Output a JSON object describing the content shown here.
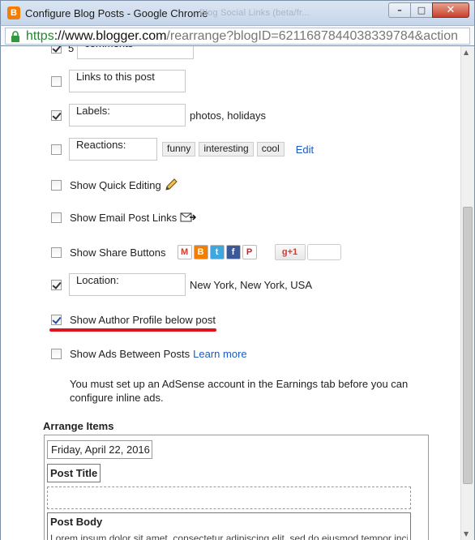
{
  "window": {
    "title": "Configure Blog Posts - Google Chrome",
    "background_tabs": "Blog               Social Links (beta/fr...",
    "url_scheme": "https",
    "url_host": "://www.blogger.com",
    "url_path": "/rearrange?blogID=6211687844038339784&action"
  },
  "options": {
    "comments": {
      "checked": true,
      "prefix": "5",
      "field": "comments"
    },
    "links_to_post": {
      "checked": false,
      "field": "Links to this post"
    },
    "labels": {
      "checked": true,
      "field": "Labels:",
      "value": "photos, holidays"
    },
    "reactions": {
      "checked": false,
      "field": "Reactions:",
      "tags": [
        "funny",
        "interesting",
        "cool"
      ],
      "edit_link": "Edit"
    },
    "quick_editing": {
      "checked": false,
      "label": "Show Quick Editing"
    },
    "email_links": {
      "checked": false,
      "label": "Show Email Post Links"
    },
    "share_buttons": {
      "checked": false,
      "label": "Show Share Buttons",
      "buttons": [
        "gmail",
        "blogger",
        "twitter",
        "facebook",
        "pinterest"
      ],
      "gplus_label": "+1"
    },
    "location": {
      "checked": true,
      "field": "Location:",
      "value": "New York, New York, USA"
    },
    "author_profile": {
      "checked": true,
      "label": "Show Author Profile below post"
    },
    "ads_between_posts": {
      "checked": false,
      "label": "Show Ads Between Posts",
      "link": "Learn more"
    }
  },
  "adsense_note": "You must set up an AdSense account in the Earnings tab before you can configure inline ads.",
  "arrange": {
    "title": "Arrange Items",
    "date": "Friday, April 22, 2016",
    "post_title": "Post Title",
    "post_body": "Post Body",
    "body_preview": "Lorem ipsum dolor sit amet, consectetur adipiscing elit, sed do eiusmod tempor incididunt"
  },
  "colors": {
    "link": "#1c5bbd",
    "highlight_underline": "#e0141d",
    "blogger_orange": "#f57d00"
  }
}
